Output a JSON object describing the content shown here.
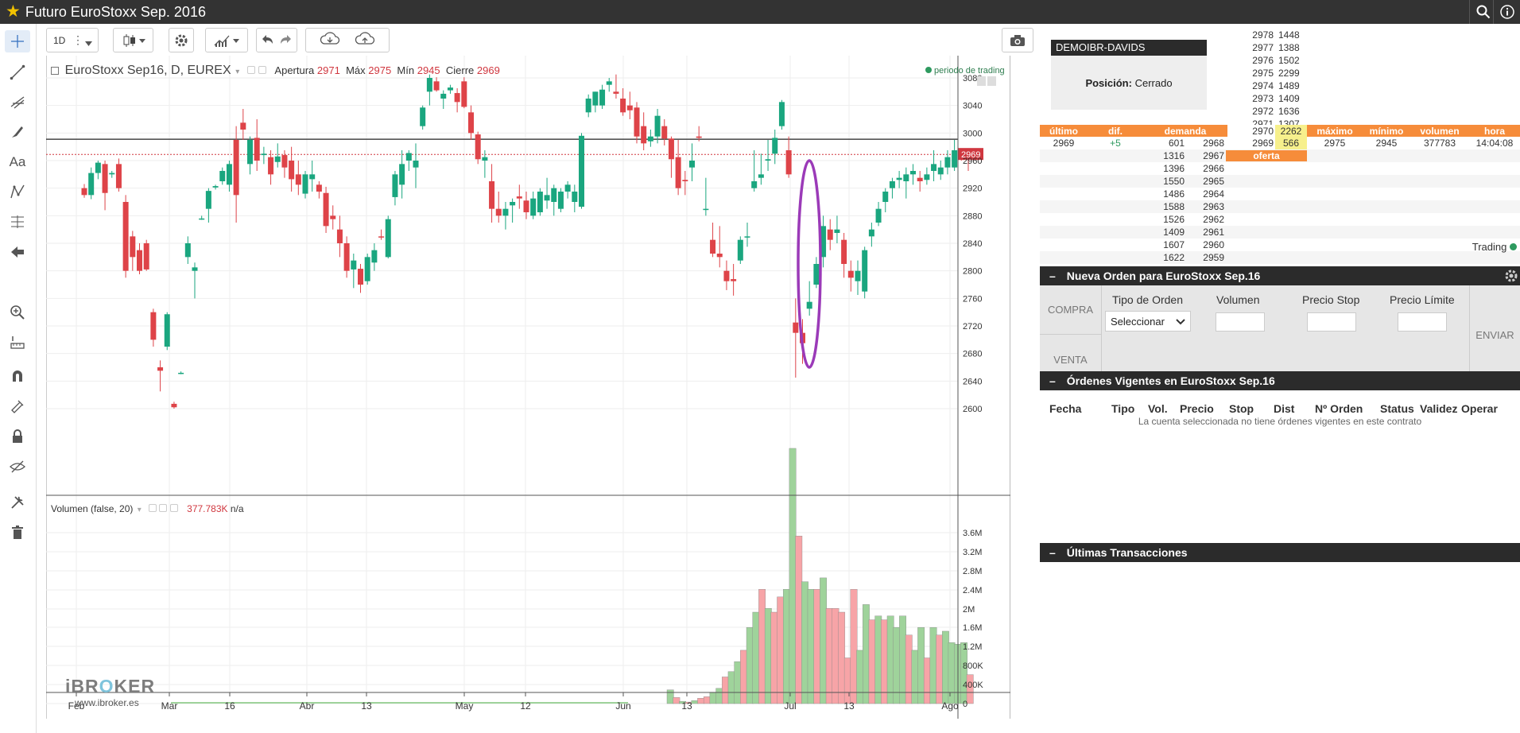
{
  "window": {
    "title": "Futuro EuroStoxx Sep. 2016"
  },
  "toolbar": {
    "interval": "1D"
  },
  "chart": {
    "symbol": "EuroStoxx Sep16, D, EUREX",
    "open_label": "Apertura",
    "open": "2971",
    "high_label": "Máx",
    "high": "2975",
    "low_label": "Mín",
    "low": "2945",
    "close_label": "Cierre",
    "close": "2969",
    "session": "periodo de trading",
    "last_price_tag": "2969",
    "volume_title": "Volumen (false, 20)",
    "volume_value": "377.783K",
    "volume_na": "n/a",
    "logo_a": "iBR",
    "logo_b": "O",
    "logo_c": "KER",
    "logo_url": "www.ibroker.es",
    "colors": {
      "up": "#1aa67f",
      "down": "#de4348",
      "vol_up": "#9fd39b",
      "vol_down": "#f7a4a7",
      "ellipse": "#9b3ab8"
    }
  },
  "chart_data": [
    {
      "type": "candlestick",
      "title": "EuroStoxx Sep16, D, EUREX",
      "x_ticks": [
        "Feb",
        "Mar",
        "16",
        "Abr",
        "13",
        "May",
        "12",
        "Jun",
        "13",
        "Jul",
        "13",
        "Ago"
      ],
      "y_ticks": [
        2600,
        2640,
        2680,
        2720,
        2760,
        2800,
        2840,
        2880,
        2920,
        2960,
        3000,
        3040,
        3080
      ],
      "ylim": [
        2575,
        3095
      ],
      "reference_line": 2991,
      "last_price": 2969,
      "ohlc": [
        [
          2920,
          2926,
          2906,
          2910
        ],
        [
          2910,
          2950,
          2904,
          2942
        ],
        [
          2942,
          2960,
          2933,
          2957
        ],
        [
          2955,
          2960,
          2888,
          2913
        ],
        [
          2940,
          2945,
          2935,
          2942
        ],
        [
          2955,
          2963,
          2915,
          2920
        ],
        [
          2900,
          2910,
          2790,
          2800
        ],
        [
          2850,
          2858,
          2800,
          2820
        ],
        [
          2830,
          2840,
          2795,
          2800
        ],
        [
          2840,
          2845,
          2800,
          2802
        ],
        [
          2740,
          2745,
          2690,
          2700
        ],
        [
          2660,
          2670,
          2625,
          2655
        ],
        [
          2690,
          2740,
          2685,
          2737
        ],
        [
          2607,
          2610,
          2600,
          2602
        ],
        [
          2652,
          2654,
          2650,
          2652
        ],
        [
          2820,
          2850,
          2810,
          2840
        ],
        [
          2800,
          2812,
          2760,
          2805
        ],
        [
          2876,
          2880,
          2874,
          2876
        ],
        [
          2890,
          2920,
          2870,
          2916
        ],
        [
          2921,
          2925,
          2918,
          2923
        ],
        [
          2930,
          2950,
          2925,
          2945
        ],
        [
          2925,
          2960,
          2915,
          2955
        ],
        [
          2990,
          3010,
          2870,
          2910
        ],
        [
          3015,
          3035,
          2990,
          3005
        ],
        [
          2955,
          2995,
          2940,
          2990
        ],
        [
          2993,
          3020,
          2945,
          2960
        ],
        [
          2968,
          2980,
          2955,
          2970
        ],
        [
          2965,
          2975,
          2925,
          2940
        ],
        [
          2958,
          2985,
          2950,
          2966
        ],
        [
          2968,
          2975,
          2935,
          2950
        ],
        [
          2960,
          2980,
          2915,
          2933
        ],
        [
          2940,
          2960,
          2910,
          2925
        ],
        [
          2912,
          2945,
          2905,
          2940
        ],
        [
          2933,
          2960,
          2915,
          2940
        ],
        [
          2925,
          2930,
          2905,
          2915
        ],
        [
          2913,
          2922,
          2855,
          2865
        ],
        [
          2880,
          2895,
          2860,
          2875
        ],
        [
          2860,
          2880,
          2820,
          2840
        ],
        [
          2840,
          2850,
          2790,
          2800
        ],
        [
          2802,
          2825,
          2775,
          2815
        ],
        [
          2803,
          2810,
          2768,
          2780
        ],
        [
          2785,
          2825,
          2780,
          2820
        ],
        [
          2812,
          2840,
          2800,
          2830
        ],
        [
          2850,
          2860,
          2845,
          2849
        ],
        [
          2820,
          2880,
          2818,
          2875
        ],
        [
          2907,
          2945,
          2895,
          2940
        ],
        [
          2925,
          2975,
          2905,
          2955
        ],
        [
          2960,
          2975,
          2945,
          2971
        ],
        [
          2950,
          2985,
          2920,
          2960
        ],
        [
          3010,
          3040,
          3005,
          3037
        ],
        [
          3060,
          3085,
          3040,
          3080
        ],
        [
          3075,
          3081,
          3060,
          3062
        ],
        [
          3050,
          3062,
          3035,
          3057
        ],
        [
          3062,
          3070,
          3057,
          3066
        ],
        [
          3058,
          3065,
          3030,
          3045
        ],
        [
          3075,
          3081,
          3036,
          3038
        ],
        [
          3030,
          3040,
          2990,
          3000
        ],
        [
          2998,
          3002,
          2955,
          2962
        ],
        [
          2960,
          2975,
          2935,
          2965
        ],
        [
          2930,
          2955,
          2870,
          2890
        ],
        [
          2890,
          2915,
          2870,
          2880
        ],
        [
          2880,
          2900,
          2860,
          2890
        ],
        [
          2895,
          2905,
          2870,
          2900
        ],
        [
          2908,
          2925,
          2890,
          2905
        ],
        [
          2902,
          2915,
          2875,
          2885
        ],
        [
          2880,
          2915,
          2875,
          2905
        ],
        [
          2885,
          2920,
          2880,
          2915
        ],
        [
          2902,
          2935,
          2890,
          2910
        ],
        [
          2900,
          2925,
          2880,
          2920
        ],
        [
          2890,
          2920,
          2885,
          2915
        ],
        [
          2915,
          2930,
          2905,
          2925
        ],
        [
          2900,
          2925,
          2885,
          2915
        ],
        [
          2893,
          3000,
          2890,
          2996
        ],
        [
          3030,
          3056,
          3023,
          3050
        ],
        [
          3040,
          3060,
          3030,
          3060
        ],
        [
          3040,
          3070,
          3035,
          3063
        ],
        [
          3070,
          3080,
          3060,
          3075
        ],
        [
          3060,
          3085,
          3050,
          3057
        ],
        [
          3050,
          3065,
          3025,
          3030
        ],
        [
          3040,
          3060,
          3020,
          3033
        ],
        [
          3037,
          3045,
          2985,
          2995
        ],
        [
          3010,
          3030,
          2975,
          2985
        ],
        [
          2988,
          3005,
          2980,
          2995
        ],
        [
          2995,
          3035,
          2985,
          3025
        ],
        [
          3010,
          3020,
          2982,
          2992
        ],
        [
          2992,
          2995,
          2935,
          2962
        ],
        [
          2965,
          2990,
          2910,
          2920
        ],
        [
          2932,
          2945,
          2910,
          2930
        ],
        [
          2950,
          2985,
          2930,
          2960
        ],
        [
          2995,
          3010,
          2988,
          2993
        ],
        [
          2890,
          2935,
          2880,
          2890
        ],
        [
          2845,
          2870,
          2820,
          2825
        ],
        [
          2825,
          2865,
          2805,
          2820
        ],
        [
          2800,
          2815,
          2772,
          2785
        ],
        [
          2788,
          2810,
          2764,
          2785
        ],
        [
          2815,
          2850,
          2810,
          2845
        ],
        [
          2850,
          2870,
          2835,
          2850
        ],
        [
          2920,
          2975,
          2915,
          2930
        ],
        [
          2935,
          2970,
          2925,
          2940
        ],
        [
          2960,
          2990,
          2945,
          2962
        ],
        [
          2970,
          3005,
          2955,
          2993
        ],
        [
          3010,
          3048,
          3005,
          3045
        ],
        [
          2975,
          2995,
          2935,
          2940
        ],
        [
          2725,
          2760,
          2645,
          2710
        ],
        [
          2710,
          2730,
          2665,
          2695
        ],
        [
          2745,
          2785,
          2735,
          2755
        ],
        [
          2780,
          2820,
          2775,
          2810
        ],
        [
          2820,
          2880,
          2805,
          2865
        ],
        [
          2860,
          2875,
          2830,
          2845
        ],
        [
          2855,
          2880,
          2840,
          2860
        ],
        [
          2845,
          2855,
          2790,
          2810
        ],
        [
          2800,
          2815,
          2770,
          2790
        ],
        [
          2785,
          2815,
          2765,
          2800
        ],
        [
          2770,
          2835,
          2760,
          2830
        ],
        [
          2850,
          2870,
          2835,
          2860
        ],
        [
          2870,
          2900,
          2865,
          2890
        ],
        [
          2900,
          2920,
          2885,
          2915
        ],
        [
          2920,
          2935,
          2905,
          2930
        ],
        [
          2932,
          2945,
          2920,
          2935
        ],
        [
          2930,
          2950,
          2905,
          2940
        ],
        [
          2940,
          2955,
          2925,
          2945
        ],
        [
          2935,
          2945,
          2915,
          2930
        ],
        [
          2932,
          2950,
          2925,
          2940
        ],
        [
          2945,
          2975,
          2930,
          2955
        ],
        [
          2940,
          2960,
          2932,
          2950
        ],
        [
          2950,
          2975,
          2940,
          2965
        ],
        [
          2950,
          2990,
          2945,
          2975
        ],
        [
          2970,
          2975,
          2960,
          2969
        ],
        [
          2971,
          2975,
          2945,
          2969
        ]
      ]
    },
    {
      "type": "bar",
      "title": "Volumen (false, 20)",
      "y_ticks": [
        "0",
        "400K",
        "800K",
        "1.2M",
        "1.6M",
        "2M",
        "2.4M",
        "2.8M",
        "3.2M",
        "3.6M"
      ],
      "ylim": [
        0,
        3600000
      ],
      "last_value": "377.783K",
      "values": [
        180000,
        80000,
        30000,
        20000,
        40000,
        70000,
        90000,
        150000,
        200000,
        350000,
        420000,
        550000,
        700000,
        1000000,
        1200000,
        1500000,
        1250000,
        1200000,
        1400000,
        1500000,
        3350000,
        2200000,
        1600000,
        1500000,
        1500000,
        1650000,
        1250000,
        1250000,
        1200000,
        600000,
        1500000,
        700000,
        1300000,
        1100000,
        1150000,
        1100000,
        1150000,
        1000000,
        1150000,
        900000,
        700000,
        1000000,
        600000,
        1000000,
        900000,
        950000,
        800000,
        780000,
        800000,
        380000
      ],
      "colors": [
        "up",
        "down",
        "up",
        "down",
        "up",
        "down",
        "down",
        "up",
        "up",
        "down",
        "up",
        "up",
        "down",
        "up",
        "up",
        "down",
        "up",
        "down",
        "down",
        "up",
        "up",
        "down",
        "up",
        "up",
        "down",
        "up",
        "down",
        "down",
        "down",
        "down",
        "down",
        "up",
        "up",
        "down",
        "up",
        "down",
        "up",
        "up",
        "up",
        "down",
        "up",
        "up",
        "down",
        "up",
        "down",
        "up",
        "up",
        "up",
        "up",
        "down"
      ]
    }
  ],
  "account": {
    "name": "DEMOIBR-DAVIDS",
    "position_label": "Posición:",
    "position_value": "Cerrado"
  },
  "orderbook": {
    "asks": [
      [
        "2978",
        "1448"
      ],
      [
        "2977",
        "1388"
      ],
      [
        "2976",
        "1502"
      ],
      [
        "2975",
        "2299"
      ],
      [
        "2974",
        "1489"
      ],
      [
        "2973",
        "1409"
      ],
      [
        "2972",
        "1636"
      ],
      [
        "2971",
        "1307"
      ],
      [
        "2970",
        "2262"
      ],
      [
        "2969",
        "566"
      ]
    ],
    "headers": {
      "last": "último",
      "change": "dif.",
      "bid": "demanda",
      "high": "máximo",
      "low": "mínimo",
      "volume": "volumen",
      "time": "hora",
      "offer": "oferta"
    },
    "quote": {
      "last": "2969",
      "change": "+5",
      "high": "2975",
      "low": "2945",
      "volume": "377783",
      "time": "14:04:08"
    },
    "bids": [
      [
        "601",
        "2968"
      ],
      [
        "1316",
        "2967"
      ],
      [
        "1396",
        "2966"
      ],
      [
        "1550",
        "2965"
      ],
      [
        "1486",
        "2964"
      ],
      [
        "1588",
        "2963"
      ],
      [
        "1526",
        "2962"
      ],
      [
        "1409",
        "2961"
      ],
      [
        "1607",
        "2960"
      ],
      [
        "1622",
        "2959"
      ]
    ],
    "trading_label": "Trading"
  },
  "order_form": {
    "title": "Nueva Orden para EuroStoxx Sep.16",
    "buy": "COMPRA",
    "sell": "VENTA",
    "type_label": "Tipo de Orden",
    "type_value": "Seleccionar",
    "volume_label": "Volumen",
    "stop_label": "Precio Stop",
    "limit_label": "Precio Límite",
    "send": "ENVIAR"
  },
  "orders": {
    "title": "Órdenes Vigentes en EuroStoxx Sep.16",
    "columns": [
      "Fecha",
      "Tipo",
      "Vol.",
      "Precio",
      "Stop",
      "Dist",
      "Nº Orden",
      "Status",
      "Validez",
      "Operar"
    ],
    "empty": "La cuenta seleccionada no tiene órdenes vigentes en este contrato"
  },
  "trades": {
    "title": "Últimas Transacciones"
  }
}
